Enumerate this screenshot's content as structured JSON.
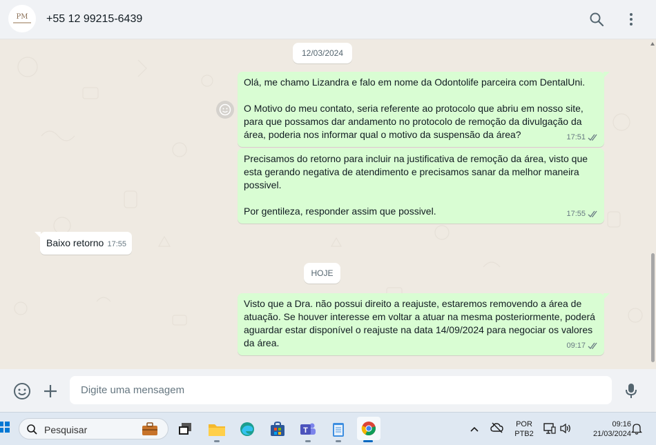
{
  "header": {
    "avatar_monogram": "PM",
    "contact_name": "+55 12 99215-6439",
    "search_icon": "search-icon",
    "menu_icon": "kebab-menu-icon"
  },
  "chat": {
    "date_chips": [
      "12/03/2024",
      "HOJE"
    ],
    "messages": [
      {
        "direction": "out",
        "text": "Olá, me chamo Lizandra e falo em nome da Odontolife parceira com DentalUni.\n\nO Motivo do meu contato, seria referente ao protocolo que abriu em nosso site, para que possamos dar andamento no protocolo de remoção da divulgação da área, poderia nos informar qual o motivo da suspensão da área?",
        "time": "17:51",
        "status": "read"
      },
      {
        "direction": "out",
        "text": "Precisamos do retorno para incluir na justificativa de remoção da área, visto que esta gerando negativa de atendimento e precisamos sanar da melhor maneira possivel.\n\nPor gentileza, responder assim que possivel.",
        "time": "17:55",
        "status": "read"
      },
      {
        "direction": "in",
        "text": "Baixo retorno",
        "time": "17:55"
      },
      {
        "direction": "out",
        "text": "Visto que a Dra. não possui direito a reajuste, estaremos removendo a área de atuação. Se houver interesse em voltar a atuar na mesma posteriormente, poderá aguardar estar disponível o reajuste na data 14/09/2024 para negociar os valores da área.",
        "time": "09:17",
        "status": "read"
      }
    ]
  },
  "composer": {
    "placeholder": "Digite uma mensagem",
    "emoji_icon": "emoji-icon",
    "attach_icon": "plus-icon",
    "mic_icon": "microphone-icon"
  },
  "taskbar": {
    "search_label": "Pesquisar",
    "language_line1": "POR",
    "language_line2": "PTB2",
    "time": "09:16",
    "date": "21/03/2024"
  },
  "colors": {
    "outgoing_bubble": "#d9fdd3",
    "incoming_bubble": "#ffffff",
    "chat_background": "#efeae2",
    "read_tick": "#667781"
  }
}
